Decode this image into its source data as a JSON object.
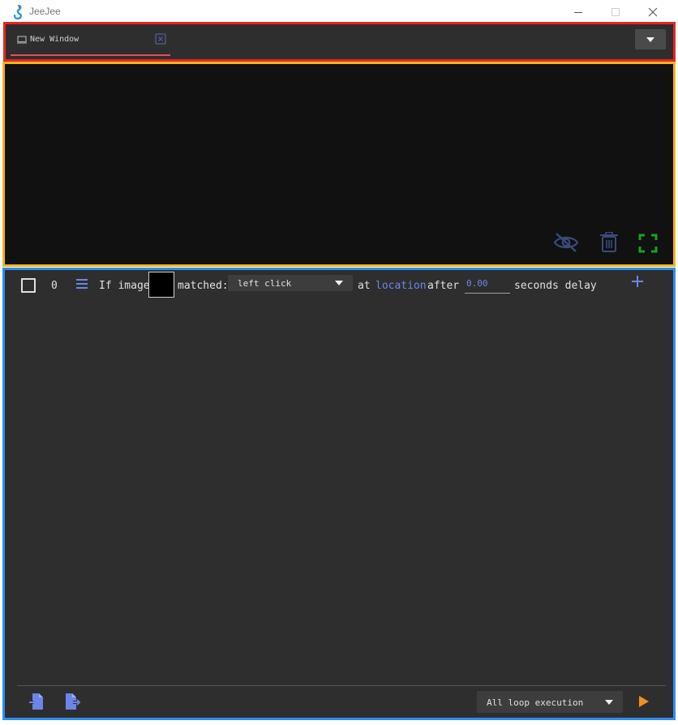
{
  "window": {
    "title": "JeeJee"
  },
  "tabs": [
    {
      "label": "New Window",
      "active": true
    }
  ],
  "preview": {
    "tools": [
      "eye-off-icon",
      "trash-icon",
      "fullscreen-icon"
    ]
  },
  "actions": [
    {
      "index": "0",
      "checked": false,
      "if_text": "If image",
      "matched_text": "matched:",
      "action_value": "left click",
      "at_text": "at",
      "location_text": "location",
      "after_text": "after",
      "delay_value": "0.00",
      "seconds_text": "seconds delay"
    }
  ],
  "footer": {
    "loop_mode": "All loop execution"
  },
  "colors": {
    "accent_blue": "#6d84e8",
    "play_orange": "#f0901e",
    "fullscreen_green": "#1aa31a",
    "tab_underline": "#e05060"
  }
}
